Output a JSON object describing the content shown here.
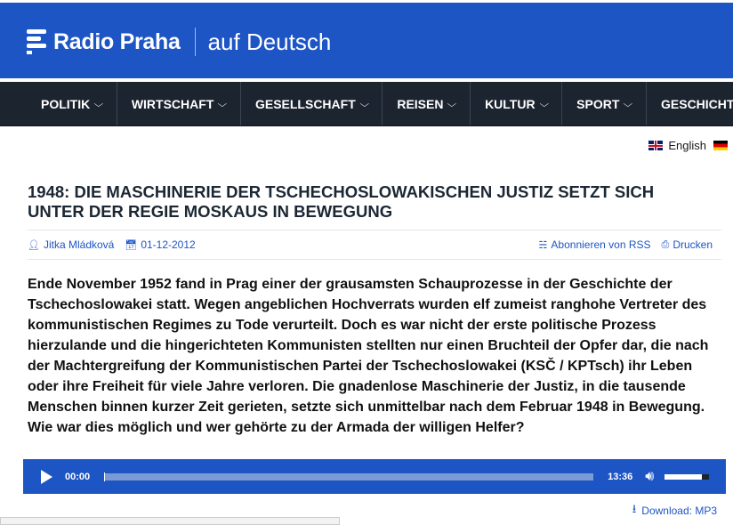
{
  "header": {
    "brand": "Radio Praha",
    "subtitle": "auf Deutsch"
  },
  "nav": {
    "items": [
      {
        "label": "POLITIK"
      },
      {
        "label": "WIRTSCHAFT"
      },
      {
        "label": "GESELLSCHAFT"
      },
      {
        "label": "REISEN"
      },
      {
        "label": "KULTUR"
      },
      {
        "label": "SPORT"
      },
      {
        "label": "GESCHICHTE"
      }
    ],
    "chevron": "⌵"
  },
  "language": {
    "label": "English"
  },
  "article": {
    "title": "1948: Die Maschinerie der tschechoslowakischen Justiz setzt sich unter der Regie Moskaus in Bewegung",
    "author": "Jitka Mládková",
    "date": "01-12-2012",
    "rss_label": "Abonnieren von RSS",
    "print_label": "Drucken",
    "lead": "Ende November 1952 fand in Prag einer der grausamsten Schauprozesse in der Geschichte der Tschechoslowakei statt. Wegen angeblichen Hochverrats wurden elf zumeist ranghohe Vertreter des kommunistischen Regimes zu Tode verurteilt. Doch es war nicht der erste politische Prozess hierzulande und die hingerichteten Kommunisten stellten nur einen Bruchteil der Opfer dar, die nach der Machtergreifung der Kommunistischen Partei der Tschechoslowakei (KSČ / KPTsch) ihr Leben oder ihre Freiheit für viele Jahre verloren. Die gnadenlose Maschinerie der Justiz, in die tausende Menschen binnen kurzer Zeit gerieten, setzte sich unmittelbar nach dem Februar 1948 in Bewegung. Wie war dies möglich und wer gehörte zu der Armada der willigen Helfer?"
  },
  "player": {
    "current_time": "00:00",
    "duration": "13:36",
    "progress": 0,
    "volume": 0.85
  },
  "download": {
    "label": "Download: MP3"
  },
  "colors": {
    "brand_blue": "#1d55c4",
    "nav_bg": "#1c2430"
  },
  "icons": {
    "author": "user-icon",
    "date": "calendar-icon",
    "rss": "rss-icon",
    "print": "print-icon",
    "play": "play-icon",
    "volume": "volume-icon",
    "download": "download-icon"
  }
}
